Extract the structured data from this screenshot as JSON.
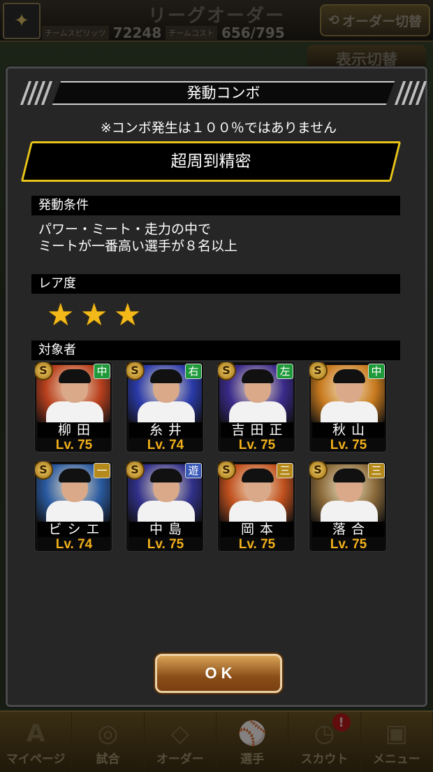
{
  "background": {
    "title": "リーグオーダー",
    "team_spirit_label": "チームスピリッツ",
    "team_spirit_value": "72248",
    "team_cost_label": "チームコスト",
    "team_cost_value": "656/795",
    "order_switch_label": "オーダー切替",
    "display_switch_label": "表示切替",
    "nav": [
      {
        "label": "マイページ",
        "icon": "A"
      },
      {
        "label": "試合",
        "icon": "◎"
      },
      {
        "label": "オーダー",
        "icon": "◇"
      },
      {
        "label": "選手",
        "icon": "⚾"
      },
      {
        "label": "スカウト",
        "icon": "◷",
        "badge": "!"
      },
      {
        "label": "メニュー",
        "icon": "▣"
      }
    ]
  },
  "modal": {
    "title": "発動コンボ",
    "notice": "※コンボ発生は１００％ではありません",
    "combo_name": "超周到精密",
    "condition_heading": "発動条件",
    "condition_line1": "パワー・ミート・走力の中で",
    "condition_line2": "ミートが一番高い選手が８名以上",
    "rarity_heading": "レア度",
    "rarity_stars": 3,
    "star_glyph": "★",
    "targets_heading": "対象者",
    "players": [
      {
        "name": "柳田",
        "level": "Lv. 75",
        "position": "中",
        "position_color": "#1f9a3a",
        "rank": "S",
        "bg": "#b8401e"
      },
      {
        "name": "糸井",
        "level": "Lv. 74",
        "position": "右",
        "position_color": "#1f9a3a",
        "rank": "S",
        "bg": "#2a3aa8"
      },
      {
        "name": "吉田正",
        "level": "Lv. 75",
        "position": "左",
        "position_color": "#1f9a3a",
        "rank": "S",
        "bg": "#3a2a8a"
      },
      {
        "name": "秋山",
        "level": "Lv. 75",
        "position": "中",
        "position_color": "#1f9a3a",
        "rank": "S",
        "bg": "#c87a1e"
      },
      {
        "name": "ビシエド",
        "level": "Lv. 74",
        "position": "一",
        "position_color": "#b58a1a",
        "rank": "S",
        "bg": "#2a5aa0"
      },
      {
        "name": "中島",
        "level": "Lv. 75",
        "position": "遊",
        "position_color": "#3a5ab8",
        "rank": "S",
        "bg": "#30308a"
      },
      {
        "name": "岡本",
        "level": "Lv. 75",
        "position": "三",
        "position_color": "#b58a1a",
        "rank": "S",
        "bg": "#c0501e"
      },
      {
        "name": "落合",
        "level": "Lv. 75",
        "position": "三",
        "position_color": "#b58a1a",
        "rank": "S",
        "bg": "#8a6a3a"
      }
    ],
    "ok_label": "OK"
  }
}
